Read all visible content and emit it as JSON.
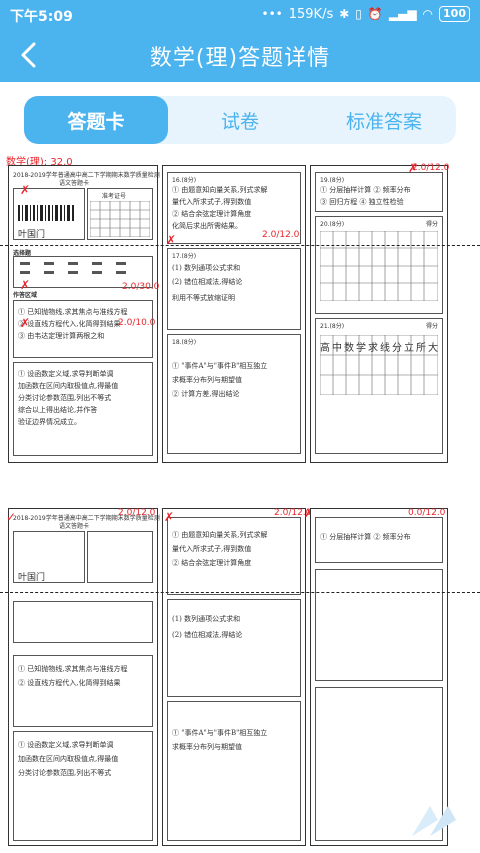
{
  "status": {
    "time": "下午5:09",
    "speed": "159K/s",
    "battery": "100"
  },
  "header": {
    "title": "数学(理)答题详情"
  },
  "tabs": [
    {
      "label": "答题卡",
      "active": true
    },
    {
      "label": "试卷",
      "active": false
    },
    {
      "label": "标准答案",
      "active": false
    }
  ],
  "sheet1": {
    "subject_score": "数学(理): 32.0",
    "score_left": "2.0/30.0",
    "score_left2": "2.0/10.0",
    "score_mid": "2.0/12.0",
    "score_right": "2.0/12.0",
    "card_title": "2018-2019学年普通高中高二下学期期末数学质量检测",
    "card_subtitle": "语文答题卡",
    "name": "叶国门",
    "box_label": "准考证号",
    "sec_choice": "选择题",
    "sec_work": "作答区域",
    "q16": "16.(8分)",
    "q17": "17.(8分)",
    "q18": "18.(8分)",
    "q19": "19.(8分)",
    "q20": "20.(8分)",
    "q21": "21.(8分)",
    "score_label": "得分",
    "grid_chars": "高中数学求线分立所大法程"
  },
  "sheet2": {
    "score_mid": "2.0/12.0",
    "score_mid2": "2.0/12.0",
    "score_right": "0.0/12.0",
    "card_title": "2018-2019学年普通高中高二下学期期末数学质量检测",
    "card_subtitle": "语文答题卡",
    "name": "叶国门"
  }
}
